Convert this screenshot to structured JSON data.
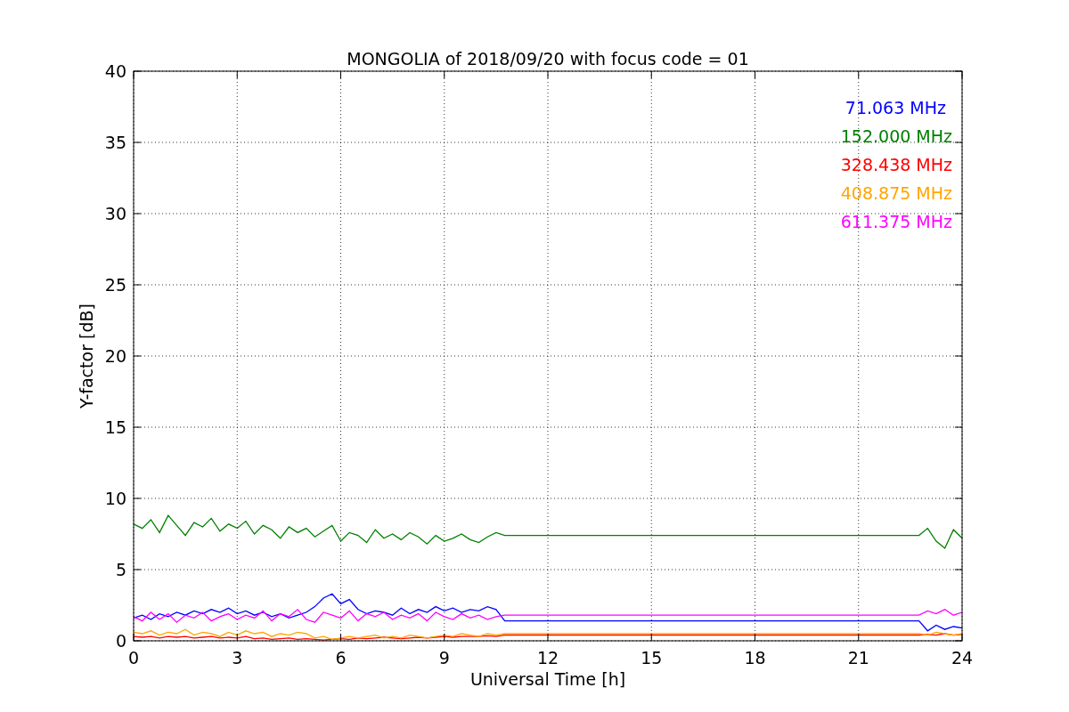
{
  "figure": {
    "chart_data": {
      "type": "line",
      "title": "MONGOLIA of 2018/09/20 with focus code = 01",
      "xlabel": "Universal Time [h]",
      "ylabel": "Y-factor [dB]",
      "x": [
        0,
        0.25,
        0.5,
        0.75,
        1,
        1.25,
        1.5,
        1.75,
        2,
        2.25,
        2.5,
        2.75,
        3,
        3.25,
        3.5,
        3.75,
        4,
        4.25,
        4.5,
        4.75,
        5,
        5.25,
        5.5,
        5.75,
        6,
        6.25,
        6.5,
        6.75,
        7,
        7.25,
        7.5,
        7.75,
        8,
        8.25,
        8.5,
        8.75,
        9,
        9.25,
        9.5,
        9.75,
        10,
        10.25,
        10.5,
        10.75,
        22.75,
        23,
        23.25,
        23.5,
        23.75,
        24
      ],
      "series": [
        {
          "name": "71.063 MHz",
          "color": "#0000ff",
          "values": [
            1.6,
            1.8,
            1.5,
            1.9,
            1.7,
            2.0,
            1.8,
            2.1,
            1.9,
            2.2,
            2.0,
            2.3,
            1.9,
            2.1,
            1.8,
            2.0,
            1.7,
            1.9,
            1.6,
            1.8,
            2.0,
            2.4,
            3.0,
            3.3,
            2.6,
            2.9,
            2.2,
            1.9,
            2.1,
            2.0,
            1.8,
            2.3,
            1.9,
            2.2,
            2.0,
            2.4,
            2.1,
            2.3,
            2.0,
            2.2,
            2.1,
            2.4,
            2.2,
            1.4,
            1.4,
            0.7,
            1.1,
            0.8,
            1.0,
            0.9
          ]
        },
        {
          "name": "152.000 MHz",
          "color": "#008000",
          "values": [
            8.2,
            7.9,
            8.5,
            7.6,
            8.8,
            8.1,
            7.4,
            8.3,
            8.0,
            8.6,
            7.7,
            8.2,
            7.9,
            8.4,
            7.5,
            8.1,
            7.8,
            7.2,
            8.0,
            7.6,
            7.9,
            7.3,
            7.7,
            8.1,
            7.0,
            7.6,
            7.4,
            6.9,
            7.8,
            7.2,
            7.5,
            7.1,
            7.6,
            7.3,
            6.8,
            7.4,
            7.0,
            7.2,
            7.5,
            7.1,
            6.9,
            7.3,
            7.6,
            7.4,
            7.4,
            7.9,
            7.0,
            6.5,
            7.8,
            7.2
          ]
        },
        {
          "name": "328.438 MHz",
          "color": "#ff0000",
          "values": [
            0.3,
            0.25,
            0.3,
            0.2,
            0.3,
            0.25,
            0.3,
            0.2,
            0.25,
            0.3,
            0.2,
            0.25,
            0.2,
            0.3,
            0.15,
            0.2,
            0.1,
            0.15,
            0.2,
            0.1,
            0.15,
            0.1,
            0.05,
            0.1,
            0.15,
            0.1,
            0.2,
            0.15,
            0.2,
            0.25,
            0.2,
            0.15,
            0.2,
            0.25,
            0.2,
            0.25,
            0.3,
            0.25,
            0.3,
            0.3,
            0.3,
            0.35,
            0.3,
            0.4,
            0.4,
            0.45,
            0.4,
            0.5,
            0.4,
            0.45
          ]
        },
        {
          "name": "408.875 MHz",
          "color": "#ffa500",
          "values": [
            0.6,
            0.5,
            0.7,
            0.4,
            0.6,
            0.5,
            0.8,
            0.4,
            0.6,
            0.5,
            0.3,
            0.6,
            0.4,
            0.7,
            0.5,
            0.6,
            0.3,
            0.5,
            0.4,
            0.6,
            0.5,
            0.2,
            0.3,
            0.1,
            0.2,
            0.3,
            0.2,
            0.3,
            0.4,
            0.2,
            0.3,
            0.2,
            0.4,
            0.3,
            0.2,
            0.3,
            0.4,
            0.3,
            0.5,
            0.4,
            0.3,
            0.5,
            0.4,
            0.5,
            0.5,
            0.4,
            0.6,
            0.5,
            0.4,
            0.5
          ]
        },
        {
          "name": "611.375 MHz",
          "color": "#ff00ff",
          "values": [
            1.7,
            1.4,
            2.0,
            1.5,
            1.9,
            1.3,
            1.8,
            1.6,
            2.0,
            1.4,
            1.7,
            1.9,
            1.5,
            1.8,
            1.6,
            2.1,
            1.4,
            1.9,
            1.7,
            2.2,
            1.5,
            1.3,
            2.0,
            1.8,
            1.6,
            2.1,
            1.4,
            1.9,
            1.7,
            2.0,
            1.5,
            1.8,
            1.6,
            1.9,
            1.4,
            2.0,
            1.7,
            1.5,
            1.9,
            1.6,
            1.8,
            1.5,
            1.7,
            1.8,
            1.8,
            2.1,
            1.9,
            2.2,
            1.8,
            2.0
          ]
        }
      ],
      "xlim": [
        0,
        24
      ],
      "ylim": [
        0,
        40
      ],
      "grid": true,
      "xticks": [
        0,
        3,
        6,
        9,
        12,
        15,
        18,
        21,
        24
      ],
      "yticks": [
        0,
        5,
        10,
        15,
        20,
        25,
        30,
        35,
        40
      ]
    }
  }
}
